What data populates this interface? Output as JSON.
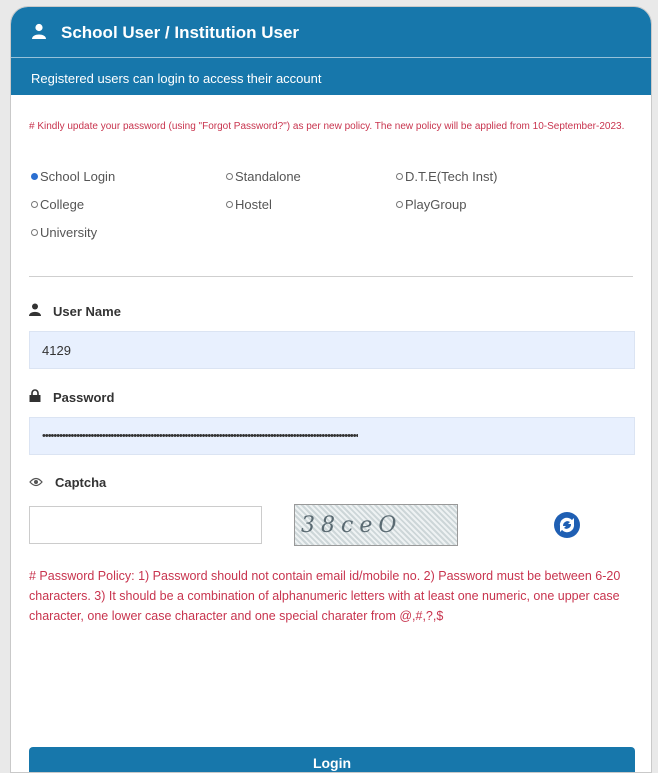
{
  "header": {
    "title": "School User / Institution User",
    "subtitle": "Registered users can login to access their account"
  },
  "notice": "# Kindly update your password (using \"Forgot Password?\") as per new policy. The new policy will be applied from 10-September-2023.",
  "login_types": [
    {
      "label": "School Login",
      "checked": true
    },
    {
      "label": "Standalone",
      "checked": false
    },
    {
      "label": "D.T.E(Tech Inst)",
      "checked": false
    },
    {
      "label": "College",
      "checked": false
    },
    {
      "label": "Hostel",
      "checked": false
    },
    {
      "label": "PlayGroup",
      "checked": false
    },
    {
      "label": "University",
      "checked": false
    }
  ],
  "username": {
    "label": "User Name",
    "value": "4129"
  },
  "password": {
    "label": "Password",
    "value": "•••••••••••••••••••••••••••••••••••••••••••••••••••••••••••••••••••••••••••••••••••••••••••••••••••••••••••••••"
  },
  "captcha": {
    "label": "Captcha",
    "value": "",
    "image_text": "38ceO"
  },
  "policy": "# Password Policy: 1) Password should not contain email id/mobile no. 2) Password must be between 6-20 characters. 3) It should be a combination of alphanumeric letters with at least one numeric, one upper case character, one lower case character and one special charater from @,#,?,$",
  "login_button": "Login",
  "colors": {
    "primary": "#1777ab",
    "alert": "#c8344e",
    "radio_checked": "#2b6fd1"
  }
}
